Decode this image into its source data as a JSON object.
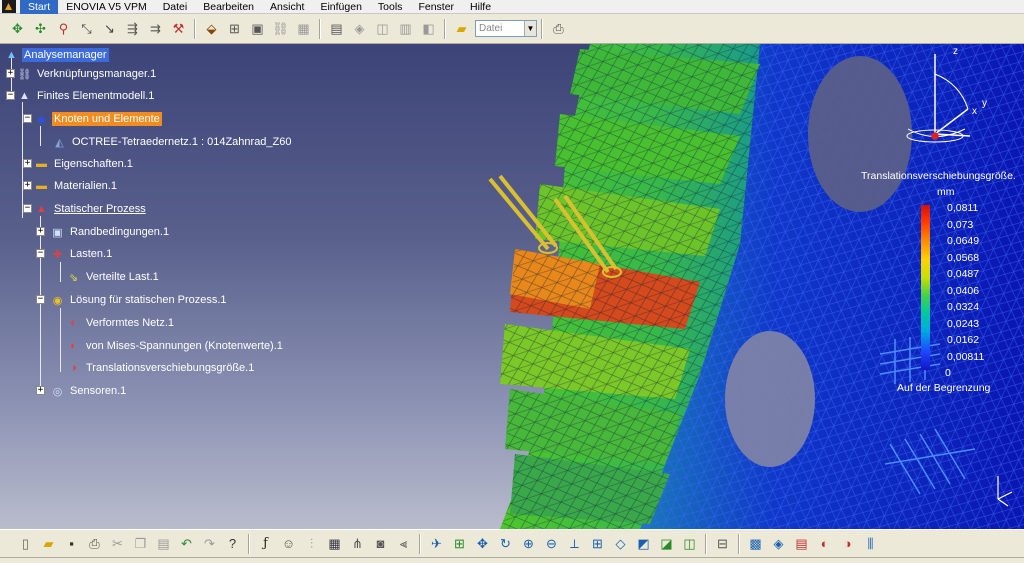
{
  "menu": {
    "items": [
      "Start",
      "ENOVIA V5 VPM",
      "Datei",
      "Bearbeiten",
      "Ansicht",
      "Einfügen",
      "Tools",
      "Fenster",
      "Hilfe"
    ]
  },
  "top_toolbar": {
    "combo_value": "Datei"
  },
  "tree": {
    "root": "Analysemanager",
    "nodes": [
      "Verknüpfungsmanager.1",
      "Finites Elementmodell.1",
      "Knoten und Elemente",
      "OCTREE-Tetraedernetz.1 : 014Zahnrad_Z60",
      "Eigenschaften.1",
      "Materialien.1",
      "Statischer Prozess",
      "Randbedingungen.1",
      "Lasten.1",
      "Verteilte Last.1",
      "Lösung für statischen Prozess.1",
      "Verformtes Netz.1",
      "von Mises-Spannungen (Knotenwerte).1",
      "Translationsverschiebungsgröße.1",
      "Sensoren.1"
    ]
  },
  "legend": {
    "title": "Translationsverschiebungsgröße.",
    "unit": "mm",
    "values": [
      "0,0811",
      "0,073",
      "0,0649",
      "0,0568",
      "0,0487",
      "0,0406",
      "0,0324",
      "0,0243",
      "0,0162",
      "0,00811",
      "0"
    ],
    "footer": "Auf der Begrenzung"
  },
  "compass": {
    "z": "z",
    "x": "x",
    "y": "y"
  },
  "colors": {
    "selection_blue": "#3c6ad8",
    "selection_orange": "#f08c20",
    "background_top": "#3c4478",
    "background_bottom": "#b9bccc"
  }
}
